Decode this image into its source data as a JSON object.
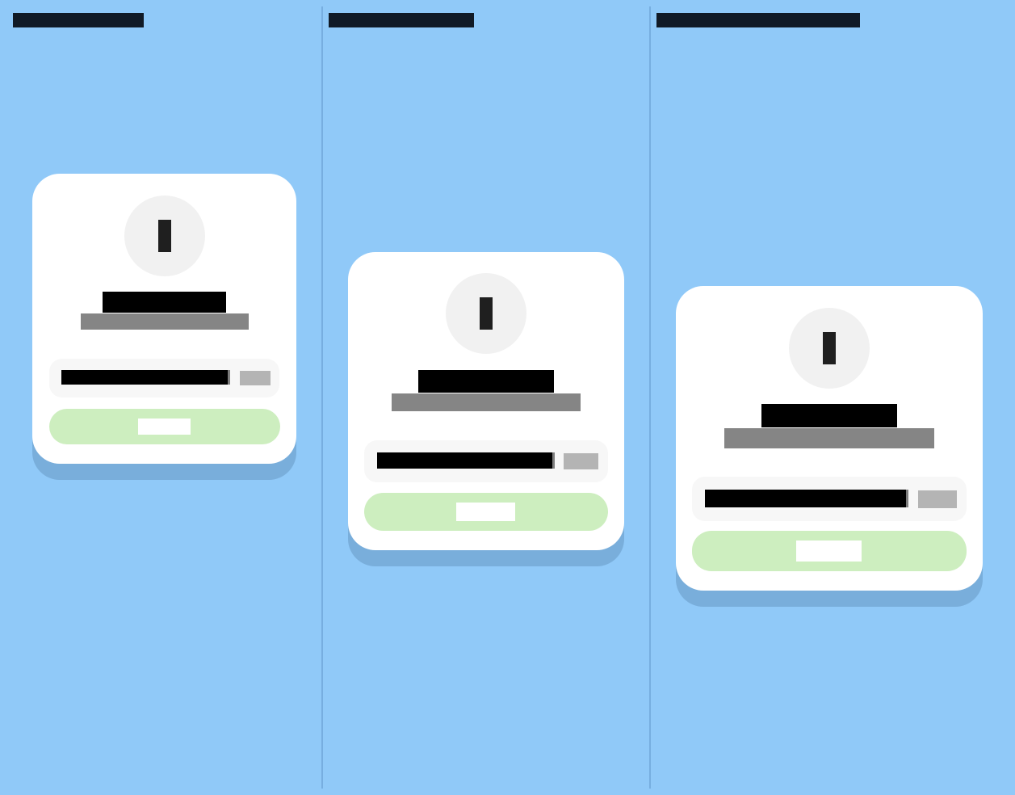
{
  "page": {
    "background": "#90c9f8",
    "divider_color": "#77aee0"
  },
  "columns": [
    {
      "title_bar_color": "#111a26",
      "card": {
        "card_bg": "#ffffff",
        "avatar_bg": "#f1f1f1",
        "icon": "vertical-bar-icon",
        "headline_color": "#000000",
        "subline_color": "#858585",
        "input_panel_bg": "#f7f7f7",
        "input_fill_color": "#000000",
        "input_action_color": "#b4b4b4",
        "button_bg": "#cdeebf",
        "button_label_color": "#ffffff"
      }
    },
    {
      "title_bar_color": "#111a26",
      "card": {
        "card_bg": "#ffffff",
        "avatar_bg": "#f1f1f1",
        "icon": "vertical-bar-icon",
        "headline_color": "#000000",
        "subline_color": "#858585",
        "input_panel_bg": "#f7f7f7",
        "input_fill_color": "#000000",
        "input_action_color": "#b4b4b4",
        "button_bg": "#cdeebf",
        "button_label_color": "#ffffff"
      }
    },
    {
      "title_bar_color": "#111a26",
      "card": {
        "card_bg": "#ffffff",
        "avatar_bg": "#f1f1f1",
        "icon": "vertical-bar-icon",
        "headline_color": "#000000",
        "subline_color": "#858585",
        "input_panel_bg": "#f7f7f7",
        "input_fill_color": "#000000",
        "input_action_color": "#b4b4b4",
        "button_bg": "#cdeebf",
        "button_label_color": "#ffffff"
      }
    }
  ]
}
